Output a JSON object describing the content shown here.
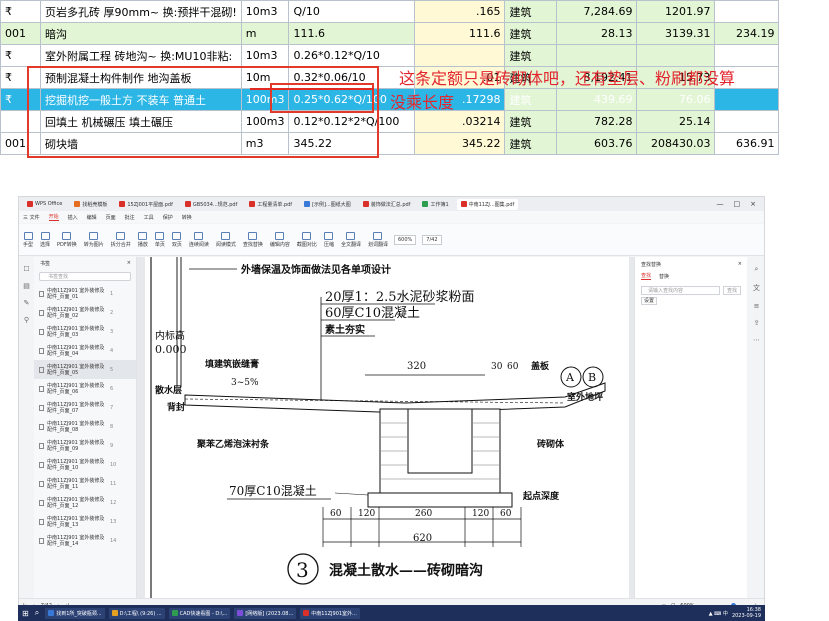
{
  "sheet": {
    "rows": [
      {
        "style": "white",
        "cells": [
          "₹",
          "页岩多孔砖 厚90mm~ 换:预拌干混砌!",
          "10m3",
          "Q/10",
          "",
          ".165",
          "建筑",
          "7,284.69",
          "1201.97",
          ""
        ]
      },
      {
        "style": "green",
        "cells": [
          "001",
          "暗沟",
          "m",
          "111.6",
          "",
          "111.6",
          "建筑",
          "28.13",
          "3139.31",
          "234.19"
        ]
      },
      {
        "style": "white",
        "cells": [
          "₹",
          "室外附属工程 砖地沟~ 换:MU10非粘:",
          "10m3",
          "0.26*0.12*Q/10",
          "",
          "",
          "建筑",
          "",
          "",
          ""
        ]
      },
      {
        "style": "white",
        "cells": [
          "₹",
          "预制混凝土构件制作 地沟盖板",
          "10m",
          "",
          "0.32*0.06/10",
          ".01",
          "建筑",
          "8,192.41",
          "15.73",
          ""
        ]
      },
      {
        "style": "cyan",
        "cells": [
          "₹",
          "挖掘机挖一般土方 不装车 普通土",
          "100m3",
          "0.25*0.62*Q/100",
          "",
          ".17298",
          "建筑",
          "439.69",
          "76.06",
          ""
        ]
      },
      {
        "style": "white",
        "cells": [
          "",
          "回填土 机械碾压 填土碾压",
          "100m3",
          "0.12*0.12*2*Q/100",
          "",
          ".03214",
          "建筑",
          "782.28",
          "25.14",
          ""
        ]
      },
      {
        "style": "white",
        "cells": [
          "001",
          "砌块墙",
          "m3",
          "345.22",
          "",
          "345.22",
          "建筑",
          "603.76",
          "208430.03",
          "636.91"
        ]
      }
    ],
    "annotation_line1": "这条定额只是砖砌体吧，还有垫层、粉刷都没算",
    "annotation_line2": "没乘长度"
  },
  "wps": {
    "tabs": [
      {
        "label": "WPS Office",
        "color": "#d9302a"
      },
      {
        "label": "找稻壳模板",
        "color": "#e46d20"
      },
      {
        "label": "15ZJ001平屋面.pdf",
        "color": "#d9302a"
      },
      {
        "label": "GB5034...规范.pdf",
        "color": "#d9302a"
      },
      {
        "label": "工程量清单.pdf",
        "color": "#d9302a"
      },
      {
        "label": "[示例]...图纸大图",
        "color": "#3a78d8"
      },
      {
        "label": "装饰做法汇总.pdf",
        "color": "#d9302a"
      },
      {
        "label": "工作簿1",
        "color": "#2e9d4f"
      },
      {
        "label": "中南11ZJ...图集.pdf",
        "color": "#d9302a"
      }
    ],
    "menu": [
      "三 文件",
      "开始",
      "插入",
      "编辑",
      "页面",
      "批注",
      "工具",
      "保护",
      "转换"
    ],
    "menu_active": "开始",
    "toolbar": [
      "手型",
      "选择",
      "PDF转换",
      "转为图片",
      "拆分合并",
      "播放",
      "单页",
      "双页",
      "连续阅读",
      "阅读模式",
      "查找替换",
      "编辑内容",
      "截图对比",
      "压缩",
      "全文翻译",
      "划词翻译"
    ],
    "zoom": "600%",
    "page_field": "7/42",
    "outline_title": "书签",
    "outline_search": "书签查找",
    "outline_items": [
      {
        "text": "中南11ZJ901 室外装修及配件_页面_01",
        "num": "1"
      },
      {
        "text": "中南11ZJ901 室外装修及配件_页面_02",
        "num": "2"
      },
      {
        "text": "中南11ZJ901 室外装修及配件_页面_03",
        "num": "3"
      },
      {
        "text": "中南11ZJ901 室外装修及配件_页面_04",
        "num": "4"
      },
      {
        "text": "中南11ZJ901 室外装修及配件_页面_05",
        "num": "5"
      },
      {
        "text": "中南11ZJ901 室外装修及配件_页面_06",
        "num": "6"
      },
      {
        "text": "中南11ZJ901 室外装修及配件_页面_07",
        "num": "7"
      },
      {
        "text": "中南11ZJ901 室外装修及配件_页面_08",
        "num": "8"
      },
      {
        "text": "中南11ZJ901 室外装修及配件_页面_09",
        "num": "9"
      },
      {
        "text": "中南11ZJ901 室外装修及配件_页面_10",
        "num": "10"
      },
      {
        "text": "中南11ZJ901 室外装修及配件_页面_11",
        "num": "11"
      },
      {
        "text": "中南11ZJ901 室外装修及配件_页面_12",
        "num": "12"
      },
      {
        "text": "中南11ZJ901 室外装修及配件_页面_13",
        "num": "13"
      },
      {
        "text": "中南11ZJ901 室外装修及配件_页面_14",
        "num": "14"
      }
    ],
    "right_panel_title": "查找替换",
    "right_tabs": [
      "查找",
      "替换"
    ],
    "right_search_placeholder": "请输入查找内容",
    "right_search_button": "查找",
    "right_settings": "设置",
    "status_left": "7/42",
    "status_right": "600%"
  },
  "drawing": {
    "title": "外墙保温及饰面做法见各单项设计",
    "layer1": "20厚1：2.5水泥砂浆粉面",
    "layer2": "60厚C10混凝土",
    "layer3": "素土夯实",
    "left_note": "内标高",
    "left_value": "0.000",
    "label_joint": "填建筑嵌缝膏",
    "label_slope": "3~5%",
    "label_scatter": "散水",
    "label_layer_bed": "散水层",
    "label_backfill": "背封",
    "label_foam": "聚苯乙烯泡沫衬条",
    "label_c10": "70厚C10混凝土",
    "label_masonry": "砖砌体",
    "label_start": "起点深度",
    "label_outdoor": "室外地坪",
    "dim_320": "320",
    "dim_30": "30",
    "dim_60": "60",
    "dim_cover": "盖板",
    "callout_a": "A",
    "callout_b": "B",
    "dim_bottom": [
      "60",
      "120",
      "260",
      "120",
      "60"
    ],
    "dim_total": "620",
    "circle_num": "3",
    "caption": "混凝土散水——砖砌暗沟"
  },
  "taskbar": {
    "apps": [
      "找到1所_突破瓶颈...",
      "D:\\工程\\ (9:26) ...",
      "CAD快速看图 - D:\\...",
      "[网络版] (2023.08...",
      "中南11ZJ901室外..."
    ],
    "clock_time": "16:38",
    "clock_date": "2023-09-19"
  }
}
